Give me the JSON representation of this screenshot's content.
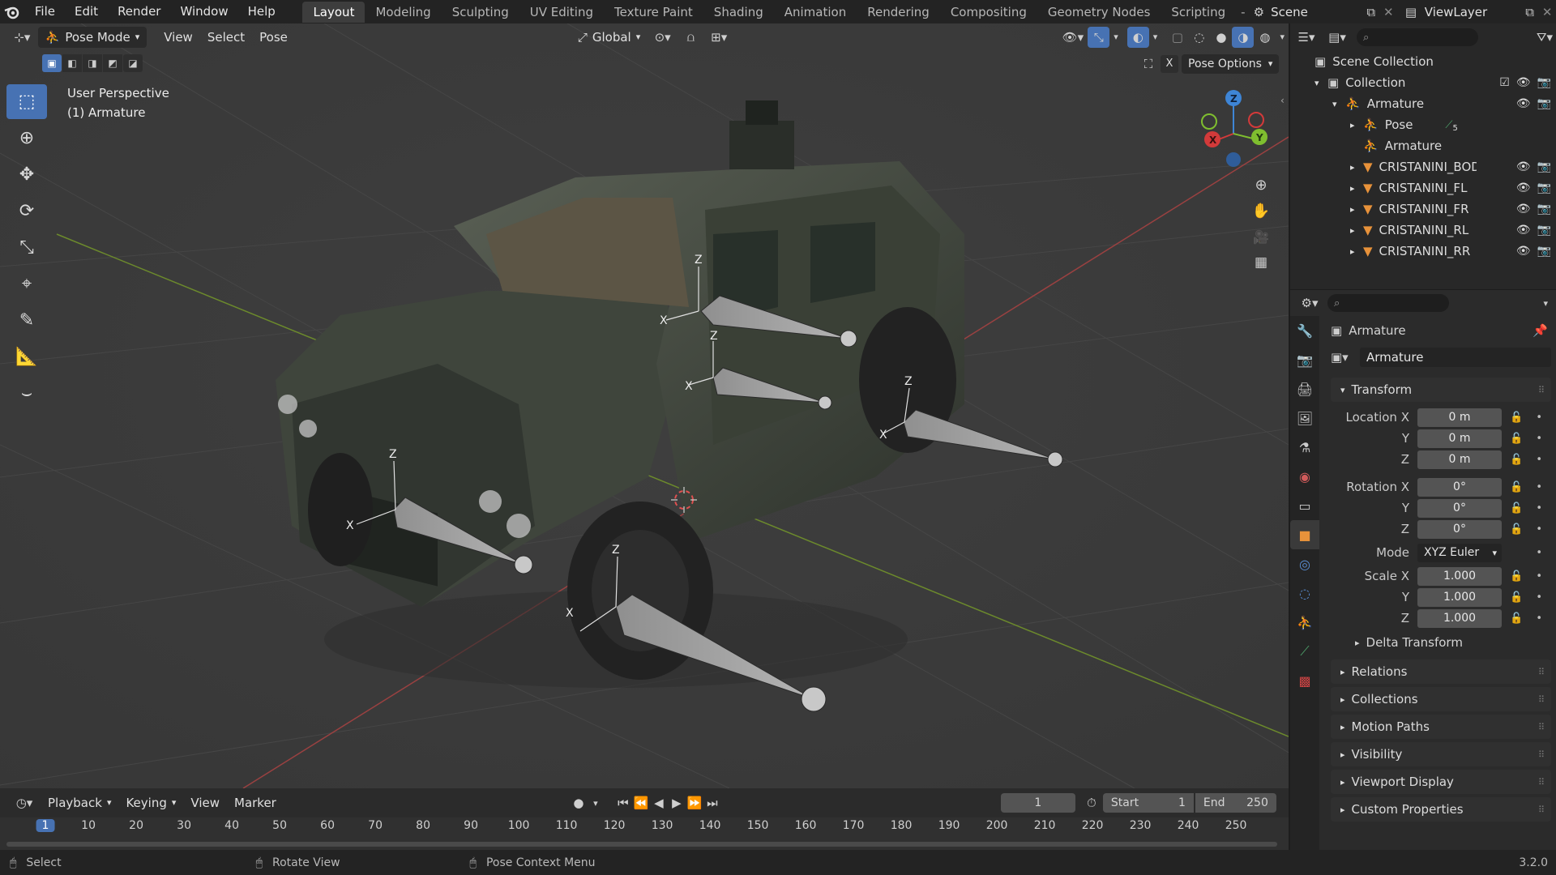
{
  "topbar": {
    "menus": [
      "File",
      "Edit",
      "Render",
      "Window",
      "Help"
    ],
    "workspaces": [
      "Layout",
      "Modeling",
      "Sculpting",
      "UV Editing",
      "Texture Paint",
      "Shading",
      "Animation",
      "Rendering",
      "Compositing",
      "Geometry Nodes",
      "Scripting"
    ],
    "active_workspace": "Layout",
    "scene": "Scene",
    "view_layer": "ViewLayer"
  },
  "viewport": {
    "mode": "Pose Mode",
    "menus": [
      "View",
      "Select",
      "Pose"
    ],
    "orientation": "Global",
    "pose_options": "Pose Options",
    "x_mirror": "X",
    "view_name": "User Perspective",
    "object_name": "(1) Armature",
    "axis_labels": {
      "x": "X",
      "y": "Y",
      "z": "Z"
    },
    "bone_labels": [
      "Z",
      "X",
      "Z",
      "X",
      "Z",
      "X",
      "Z",
      "X",
      "Z",
      "X"
    ]
  },
  "outliner": {
    "scene_collection": "Scene Collection",
    "items": [
      {
        "label": "Collection",
        "depth": 1
      },
      {
        "label": "Armature",
        "depth": 2
      },
      {
        "label": "Pose",
        "depth": 3,
        "badge": "5"
      },
      {
        "label": "Armature",
        "depth": 3
      },
      {
        "label": "CRISTANINI_BOD",
        "depth": 3
      },
      {
        "label": "CRISTANINI_FL",
        "depth": 3
      },
      {
        "label": "CRISTANINI_FR",
        "depth": 3
      },
      {
        "label": "CRISTANINI_RL",
        "depth": 3
      },
      {
        "label": "CRISTANINI_RR",
        "depth": 3
      }
    ]
  },
  "properties": {
    "context": "Armature",
    "object_name": "Armature",
    "transform_title": "Transform",
    "location": [
      {
        "label": "Location X",
        "value": "0 m"
      },
      {
        "label": "Y",
        "value": "0 m"
      },
      {
        "label": "Z",
        "value": "0 m"
      }
    ],
    "rotation": [
      {
        "label": "Rotation X",
        "value": "0°"
      },
      {
        "label": "Y",
        "value": "0°"
      },
      {
        "label": "Z",
        "value": "0°"
      }
    ],
    "mode_label": "Mode",
    "mode_value": "XYZ Euler",
    "scale": [
      {
        "label": "Scale X",
        "value": "1.000"
      },
      {
        "label": "Y",
        "value": "1.000"
      },
      {
        "label": "Z",
        "value": "1.000"
      }
    ],
    "delta": "Delta Transform",
    "sections": [
      "Relations",
      "Collections",
      "Motion Paths",
      "Visibility",
      "Viewport Display",
      "Custom Properties"
    ]
  },
  "timeline": {
    "menus": [
      "Playback",
      "Keying",
      "View",
      "Marker"
    ],
    "current_frame": "1",
    "start_label": "Start",
    "start": "1",
    "end_label": "End",
    "end": "250",
    "ruler": [
      "1",
      "10",
      "20",
      "30",
      "40",
      "50",
      "60",
      "70",
      "80",
      "90",
      "100",
      "110",
      "120",
      "130",
      "140",
      "150",
      "160",
      "170",
      "180",
      "190",
      "200",
      "210",
      "220",
      "230",
      "240",
      "250"
    ]
  },
  "statusbar": {
    "select": "Select",
    "rotate": "Rotate View",
    "context": "Pose Context Menu",
    "version": "3.2.0"
  },
  "colors": {
    "accent": "#4772b3",
    "x_axis": "#d33a3a",
    "y_axis": "#7fbe2f",
    "z_axis": "#3e85d6",
    "object_orange": "#e8923a"
  }
}
